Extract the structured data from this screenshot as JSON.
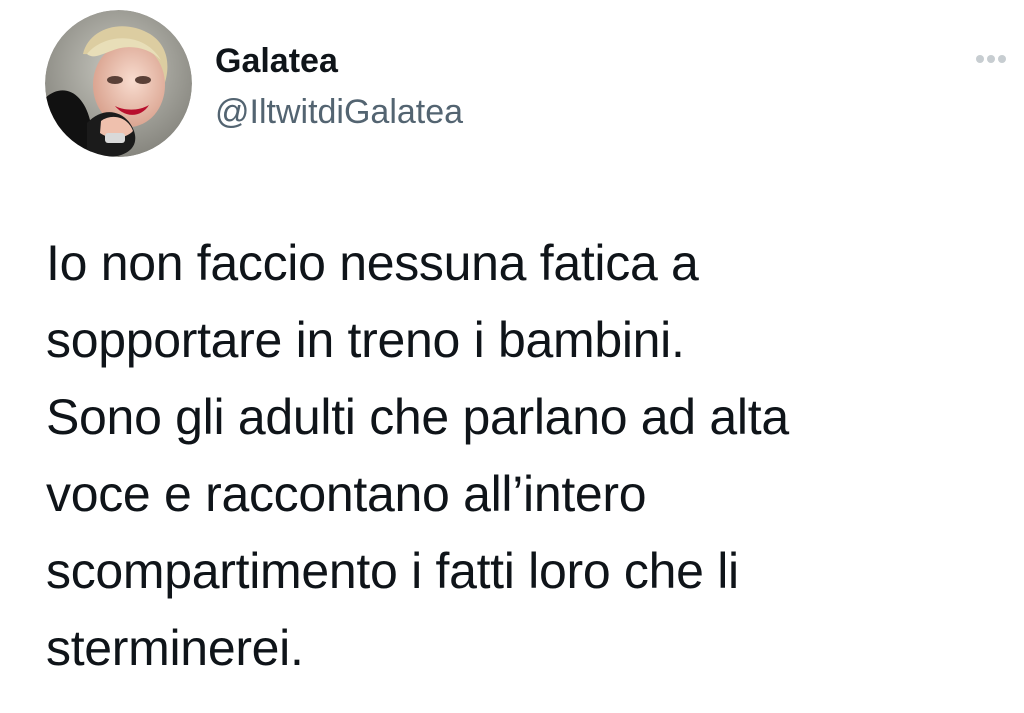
{
  "tweet": {
    "author": {
      "display_name": "Galatea",
      "handle": "@IltwitdiGalatea",
      "avatar_icon": "profile-photo"
    },
    "more_icon": "more-options-icon",
    "text_lines": [
      "Io non faccio nessuna fatica a",
      "sopportare in treno i bambini.",
      "Sono gli adulti che parlano ad alta",
      "voce e raccontano all’intero",
      "scompartimento i fatti loro che li",
      "sterminerei."
    ]
  },
  "colors": {
    "text": "#0f1419",
    "secondary_text": "#536471",
    "background": "#ffffff"
  }
}
